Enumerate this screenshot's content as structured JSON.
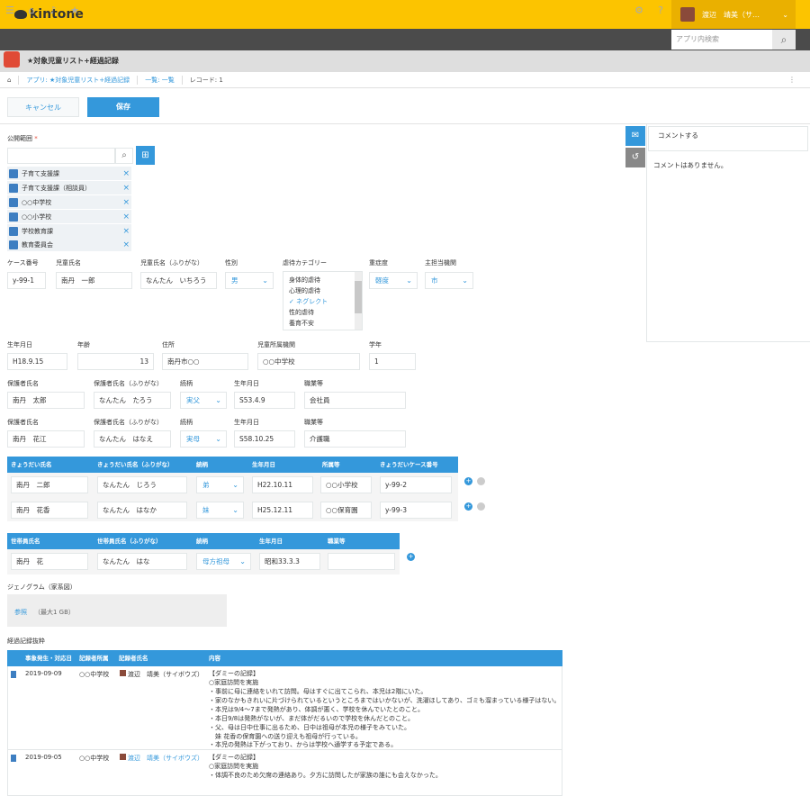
{
  "header": {
    "logo": "kintone",
    "user_name": "渡辺　靖美（サ…",
    "search_placeholder": "アプリ内検索"
  },
  "app": {
    "title": "★対象児童リスト+経過記録"
  },
  "breadcrumb": [
    "アプリ: ★対象児童リスト+経過記録",
    "一覧: 一覧",
    "レコード: 1"
  ],
  "actions": {
    "cancel": "キャンセル",
    "save": "保存"
  },
  "sidebar": {
    "comment_placeholder": "コメントする",
    "no_comments": "コメントはありません。"
  },
  "scope": {
    "label": "公開範囲",
    "required": "*",
    "entities": [
      "子育て支援課",
      "子育て支援課（相談員）",
      "○○中学校",
      "○○小学校",
      "学校教育課",
      "教育委員会"
    ]
  },
  "row1": {
    "labels": [
      "ケース番号",
      "児童氏名",
      "児童氏名（ふりがな）",
      "性別",
      "虐待カテゴリー",
      "重症度",
      "主担当機関"
    ],
    "case_no": "y-99-1",
    "name": "南丹　一郎",
    "kana": "なんたん　いちろう",
    "gender": "男",
    "severity": "軽度",
    "agency": "市",
    "abuse_options": [
      "身体的虐待",
      "心理的虐待",
      "ネグレクト",
      "性的虐待",
      "養育不安"
    ],
    "abuse_selected": "ネグレクト"
  },
  "row2": {
    "labels": [
      "生年月日",
      "年齢",
      "住所",
      "児童所属機関",
      "学年"
    ],
    "birth": "H18.9.15",
    "age": "13",
    "address": "南丹市○○",
    "school": "○○中学校",
    "grade": "1"
  },
  "guardian1": {
    "labels": [
      "保護者氏名",
      "保護者氏名（ふりがな）",
      "続柄",
      "生年月日",
      "職業等"
    ],
    "name": "南丹　太郎",
    "kana": "なんたん　たろう",
    "relation": "実父",
    "birth": "S53.4.9",
    "job": "会社員"
  },
  "guardian2": {
    "labels": [
      "保護者氏名",
      "保護者氏名（ふりがな）",
      "続柄",
      "生年月日",
      "職業等"
    ],
    "name": "南丹　花江",
    "kana": "なんたん　はなえ",
    "relation": "実母",
    "birth": "S58.10.25",
    "job": "介護職"
  },
  "siblings": {
    "headers": [
      "きょうだい氏名",
      "きょうだい氏名（ふりがな）",
      "続柄",
      "生年月日",
      "所属等",
      "きょうだいケース番号"
    ],
    "rows": [
      [
        "南丹　二郎",
        "なんたん　じろう",
        "弟",
        "H22.10.11",
        "○○小学校",
        "y-99-2"
      ],
      [
        "南丹　花香",
        "なんたん　はなか",
        "妹",
        "H25.12.11",
        "○○保育園",
        "y-99-3"
      ]
    ]
  },
  "household": {
    "headers": [
      "世帯員氏名",
      "世帯員氏名（ふりがな）",
      "続柄",
      "生年月日",
      "職業等"
    ],
    "rows": [
      [
        "南丹　花",
        "なんたん　はな",
        "母方祖母",
        "昭和33.3.3",
        ""
      ]
    ]
  },
  "genogram": {
    "label": "ジェノグラム（家系図）",
    "browse": "参照",
    "max": "（最大1 GB）"
  },
  "records": {
    "label": "経過記録抜粋",
    "headers": [
      "事象発生・対応日",
      "記録者所属",
      "記録者氏名",
      "内容"
    ],
    "rows": [
      {
        "date": "2019-09-09",
        "org": "○○中学校",
        "author": "渡辺　靖美（サイボウズ）",
        "lines": [
          "【ダミーの記録】",
          "○家庭訪問を実施",
          "・事前に母に連絡をいれて訪問。母はすぐに出てこられ、本児は2階にいた。",
          "・家のなかもきれいに片づけられているというところまではいかないが、洗濯ほしてあり、ゴミも溜まっている様子はない。",
          "・本児は9/4～7まで発熱があり、体調が悪く、学校を休んでいたとのこと。",
          "・本日9/8は発熱がないが、まだ体がだるいので学校を休んだとのこと。",
          "・父、母は日中仕事に出るため、日中は祖母が本児の様子をみていた。",
          "　妹 花香の保育園への送り迎えも祖母が行っている。",
          "・本児の発熱は下がっており、からは学校へ通学する予定である。"
        ]
      },
      {
        "date": "2019-09-05",
        "org": "○○中学校",
        "author": "渡辺　靖美（サイボウズ）",
        "lines": [
          "【ダミーの記録】",
          "○家庭訪問を実施",
          "・体調不良のため欠席の連絡あり。夕方に訪問したが家族の誰にも会えなかった。"
        ]
      }
    ]
  },
  "colors": {
    "accent": "#3498db",
    "topbar": "#fcc400",
    "navbar": "#4b4b4b"
  }
}
